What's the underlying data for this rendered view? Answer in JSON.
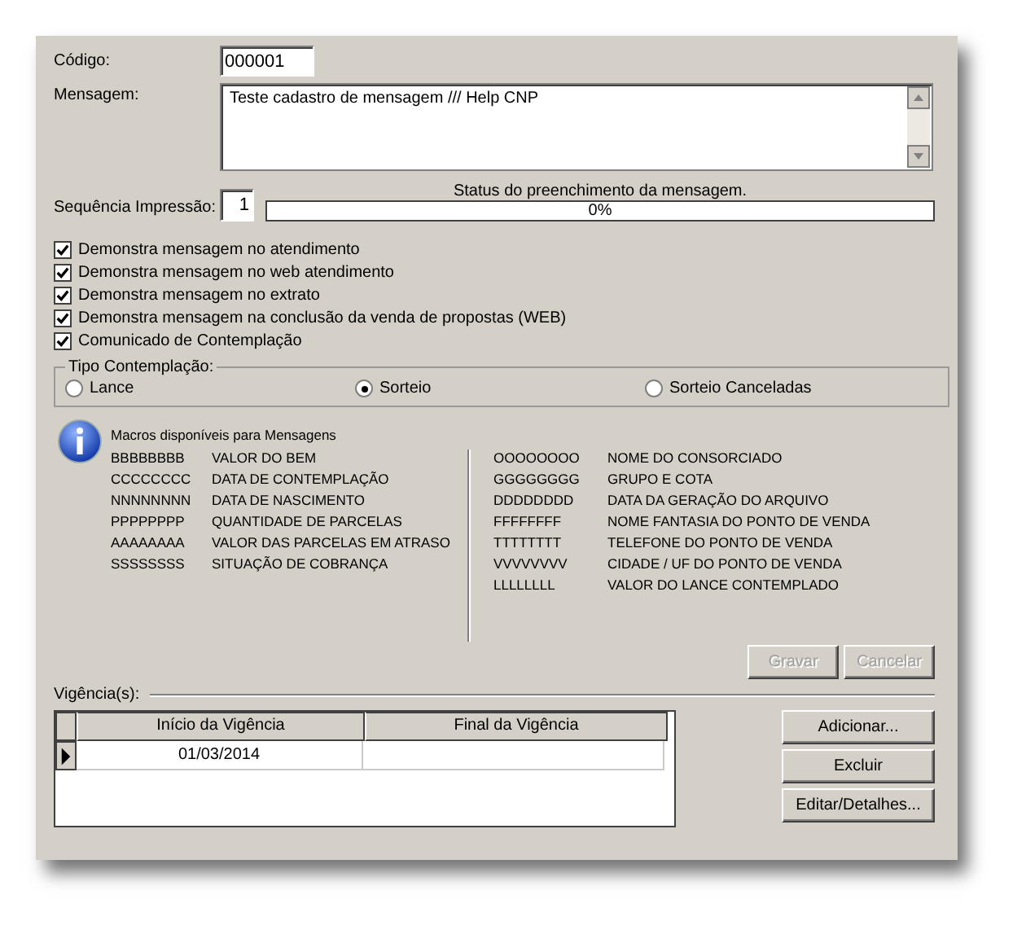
{
  "codigo": {
    "label": "Código:",
    "value": "000001"
  },
  "mensagem": {
    "label": "Mensagem:",
    "value": "Teste cadastro de mensagem /// Help CNP"
  },
  "sequencia": {
    "label": "Sequência Impressão:",
    "value": "1"
  },
  "status": {
    "label": "Status do preenchimento da mensagem.",
    "level": 0,
    "reading": "0%"
  },
  "options": [
    {
      "label": "Demonstra mensagem no atendimento",
      "checked": true
    },
    {
      "label": "Demonstra mensagem no web atendimento",
      "checked": true
    },
    {
      "label": "Demonstra mensagem no extrato",
      "checked": true
    },
    {
      "label": "Demonstra mensagem na conclusão da venda de propostas (WEB)",
      "checked": true
    },
    {
      "label": "Comunicado de Contemplação",
      "checked": true
    }
  ],
  "tipo_contemplacao": {
    "title": "Tipo Contemplação:",
    "options": [
      {
        "label": "Lance",
        "selected": false
      },
      {
        "label": "Sorteio",
        "selected": true
      },
      {
        "label": "Sorteio Canceladas",
        "selected": false
      }
    ]
  },
  "macros": {
    "title": "Macros disponíveis para Mensagens",
    "left": [
      {
        "code": "BBBBBBBB",
        "description": "VALOR DO BEM"
      },
      {
        "code": "CCCCCCCC",
        "description": "DATA DE CONTEMPLAÇÃO"
      },
      {
        "code": "NNNNNNNN",
        "description": "DATA DE NASCIMENTO"
      },
      {
        "code": "PPPPPPPP",
        "description": "QUANTIDADE DE PARCELAS"
      },
      {
        "code": "AAAAAAAA",
        "description": "VALOR DAS PARCELAS EM ATRASO"
      },
      {
        "code": "SSSSSSSS",
        "description": "SITUAÇÃO DE COBRANÇA"
      }
    ],
    "right": [
      {
        "code": "OOOOOOOO",
        "description": "NOME DO CONSORCIADO"
      },
      {
        "code": "GGGGGGGG",
        "description": "GRUPO E COTA"
      },
      {
        "code": "DDDDDDDD",
        "description": "DATA DA GERAÇÃO DO ARQUIVO"
      },
      {
        "code": "FFFFFFFF",
        "description": "NOME FANTASIA DO PONTO DE VENDA"
      },
      {
        "code": "TTTTTTTT",
        "description": "TELEFONE DO PONTO DE VENDA"
      },
      {
        "code": "VVVVVVVV",
        "description": "CIDADE / UF DO PONTO DE VENDA"
      },
      {
        "code": "LLLLLLLL",
        "description": "VALOR DO LANCE CONTEMPLADO"
      }
    ]
  },
  "form_buttons": [
    {
      "label": "Gravar",
      "disabled": true
    },
    {
      "label": "Cancelar",
      "disabled": true
    }
  ],
  "vigencias": {
    "title": "Vigência(s):",
    "columns": [
      "Início da Vigência",
      "Final da Vigência"
    ],
    "rows": [
      {
        "cells": [
          "01/03/2014",
          ""
        ],
        "current": true
      }
    ],
    "buttons": [
      {
        "label": "Adicionar...",
        "disabled": false
      },
      {
        "label": "Excluir",
        "disabled": false
      },
      {
        "label": "Editar/Detalhes...",
        "disabled": false
      }
    ]
  }
}
